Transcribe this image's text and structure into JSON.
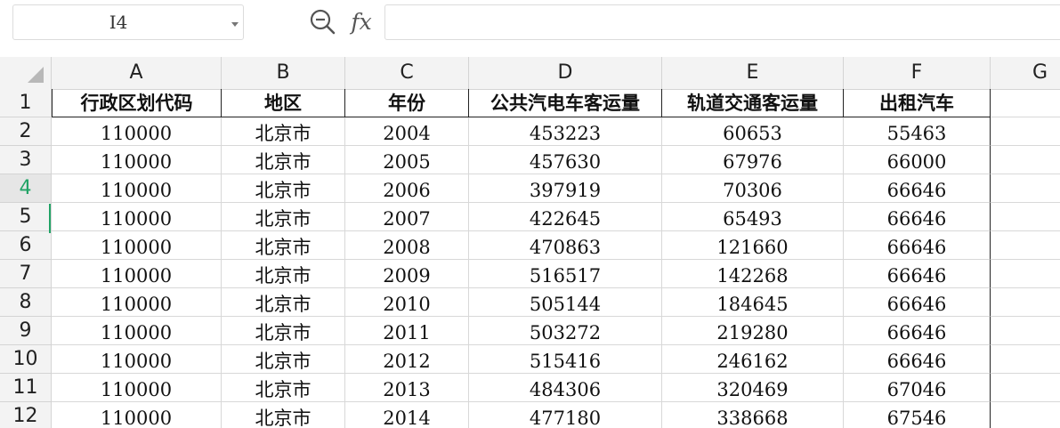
{
  "formula_bar": {
    "name_box": "I4",
    "fx_label": "fx",
    "formula_value": ""
  },
  "sheet": {
    "columns": [
      "A",
      "B",
      "C",
      "D",
      "E",
      "F",
      "G"
    ],
    "rows": [
      "1",
      "2",
      "3",
      "4",
      "5",
      "6",
      "7",
      "8",
      "9",
      "10",
      "11",
      "12"
    ],
    "active_row": "4",
    "header_cells": [
      "行政区划代码",
      "地区",
      "年份",
      "公共汽电车客运量",
      "轨道交通客运量",
      "出租汽车"
    ],
    "data": [
      [
        "110000",
        "北京市",
        "2004",
        "453223",
        "60653",
        "55463"
      ],
      [
        "110000",
        "北京市",
        "2005",
        "457630",
        "67976",
        "66000"
      ],
      [
        "110000",
        "北京市",
        "2006",
        "397919",
        "70306",
        "66646"
      ],
      [
        "110000",
        "北京市",
        "2007",
        "422645",
        "65493",
        "66646"
      ],
      [
        "110000",
        "北京市",
        "2008",
        "470863",
        "121660",
        "66646"
      ],
      [
        "110000",
        "北京市",
        "2009",
        "516517",
        "142268",
        "66646"
      ],
      [
        "110000",
        "北京市",
        "2010",
        "505144",
        "184645",
        "66646"
      ],
      [
        "110000",
        "北京市",
        "2011",
        "503272",
        "219280",
        "66646"
      ],
      [
        "110000",
        "北京市",
        "2012",
        "515416",
        "246162",
        "66646"
      ],
      [
        "110000",
        "北京市",
        "2013",
        "484306",
        "320469",
        "67046"
      ],
      [
        "110000",
        "北京市",
        "2014",
        "477180",
        "338668",
        "67546"
      ]
    ]
  }
}
